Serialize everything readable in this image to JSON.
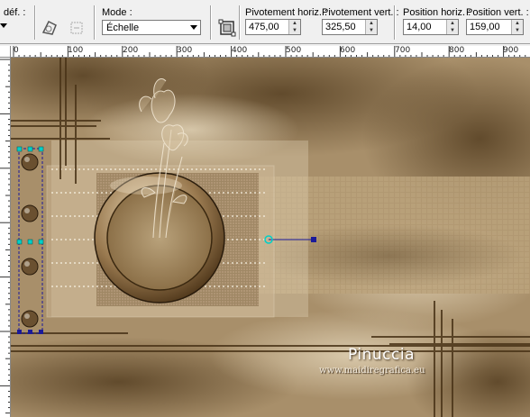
{
  "toolbar": {
    "def_label": "déf. :",
    "mode_label": "Mode :",
    "mode_value": "Échelle",
    "pivot_h_label": "Pivotement horiz. :",
    "pivot_h_value": "475,00",
    "pivot_v_label": "Pivotement vert. :",
    "pivot_v_value": "325,50",
    "pos_h_label": "Position horiz. :",
    "pos_h_value": "14,00",
    "pos_v_label": "Position vert. :",
    "pos_v_value": "159,00"
  },
  "ruler": {
    "labels": [
      "0",
      "100",
      "200",
      "300",
      "400",
      "500",
      "600",
      "700",
      "800",
      "900"
    ]
  },
  "canvas": {
    "watermark_name": "Pinuccia",
    "watermark_url": "www.maidiregrafica.eu"
  },
  "colors": {
    "handle": "#00d0c8",
    "pivot_line": "#1a1a9a",
    "background_tan": "#a88f6a",
    "dark_brown": "#4a3418"
  }
}
